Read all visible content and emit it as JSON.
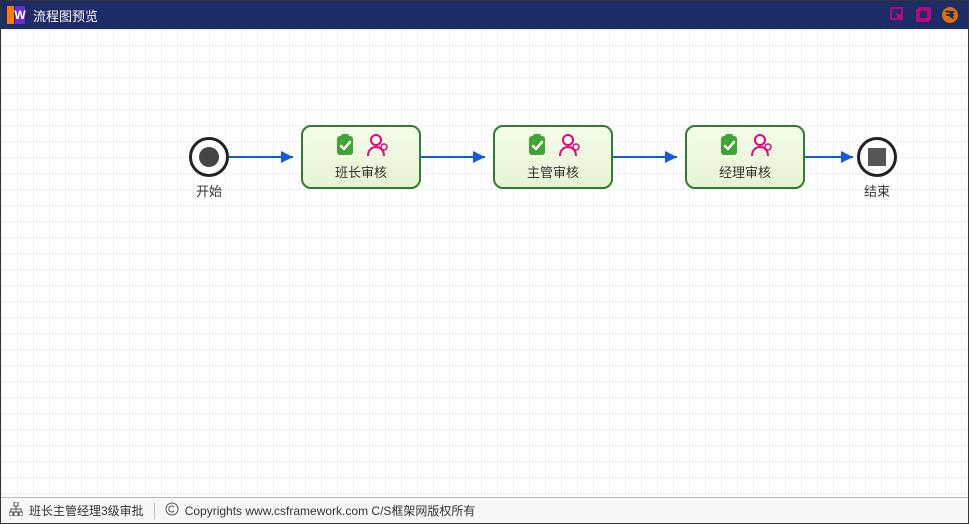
{
  "window": {
    "title": "流程图预览"
  },
  "flow": {
    "start": {
      "label": "开始"
    },
    "end": {
      "label": "结束"
    },
    "tasks": [
      {
        "label": "班长审核"
      },
      {
        "label": "主管审核"
      },
      {
        "label": "经理审核"
      }
    ]
  },
  "statusbar": {
    "workflow_name": "班长主管经理3级审批",
    "copyright": "Copyrights www.csframework.com C/S框架网版权所有"
  },
  "colors": {
    "titlebar_bg": "#1d2b67",
    "task_border": "#2e7d32",
    "accent_pink": "#e6007e",
    "accent_orange": "#d97008",
    "arrow": "#0b5ed7",
    "icon_green": "#3fa535"
  }
}
